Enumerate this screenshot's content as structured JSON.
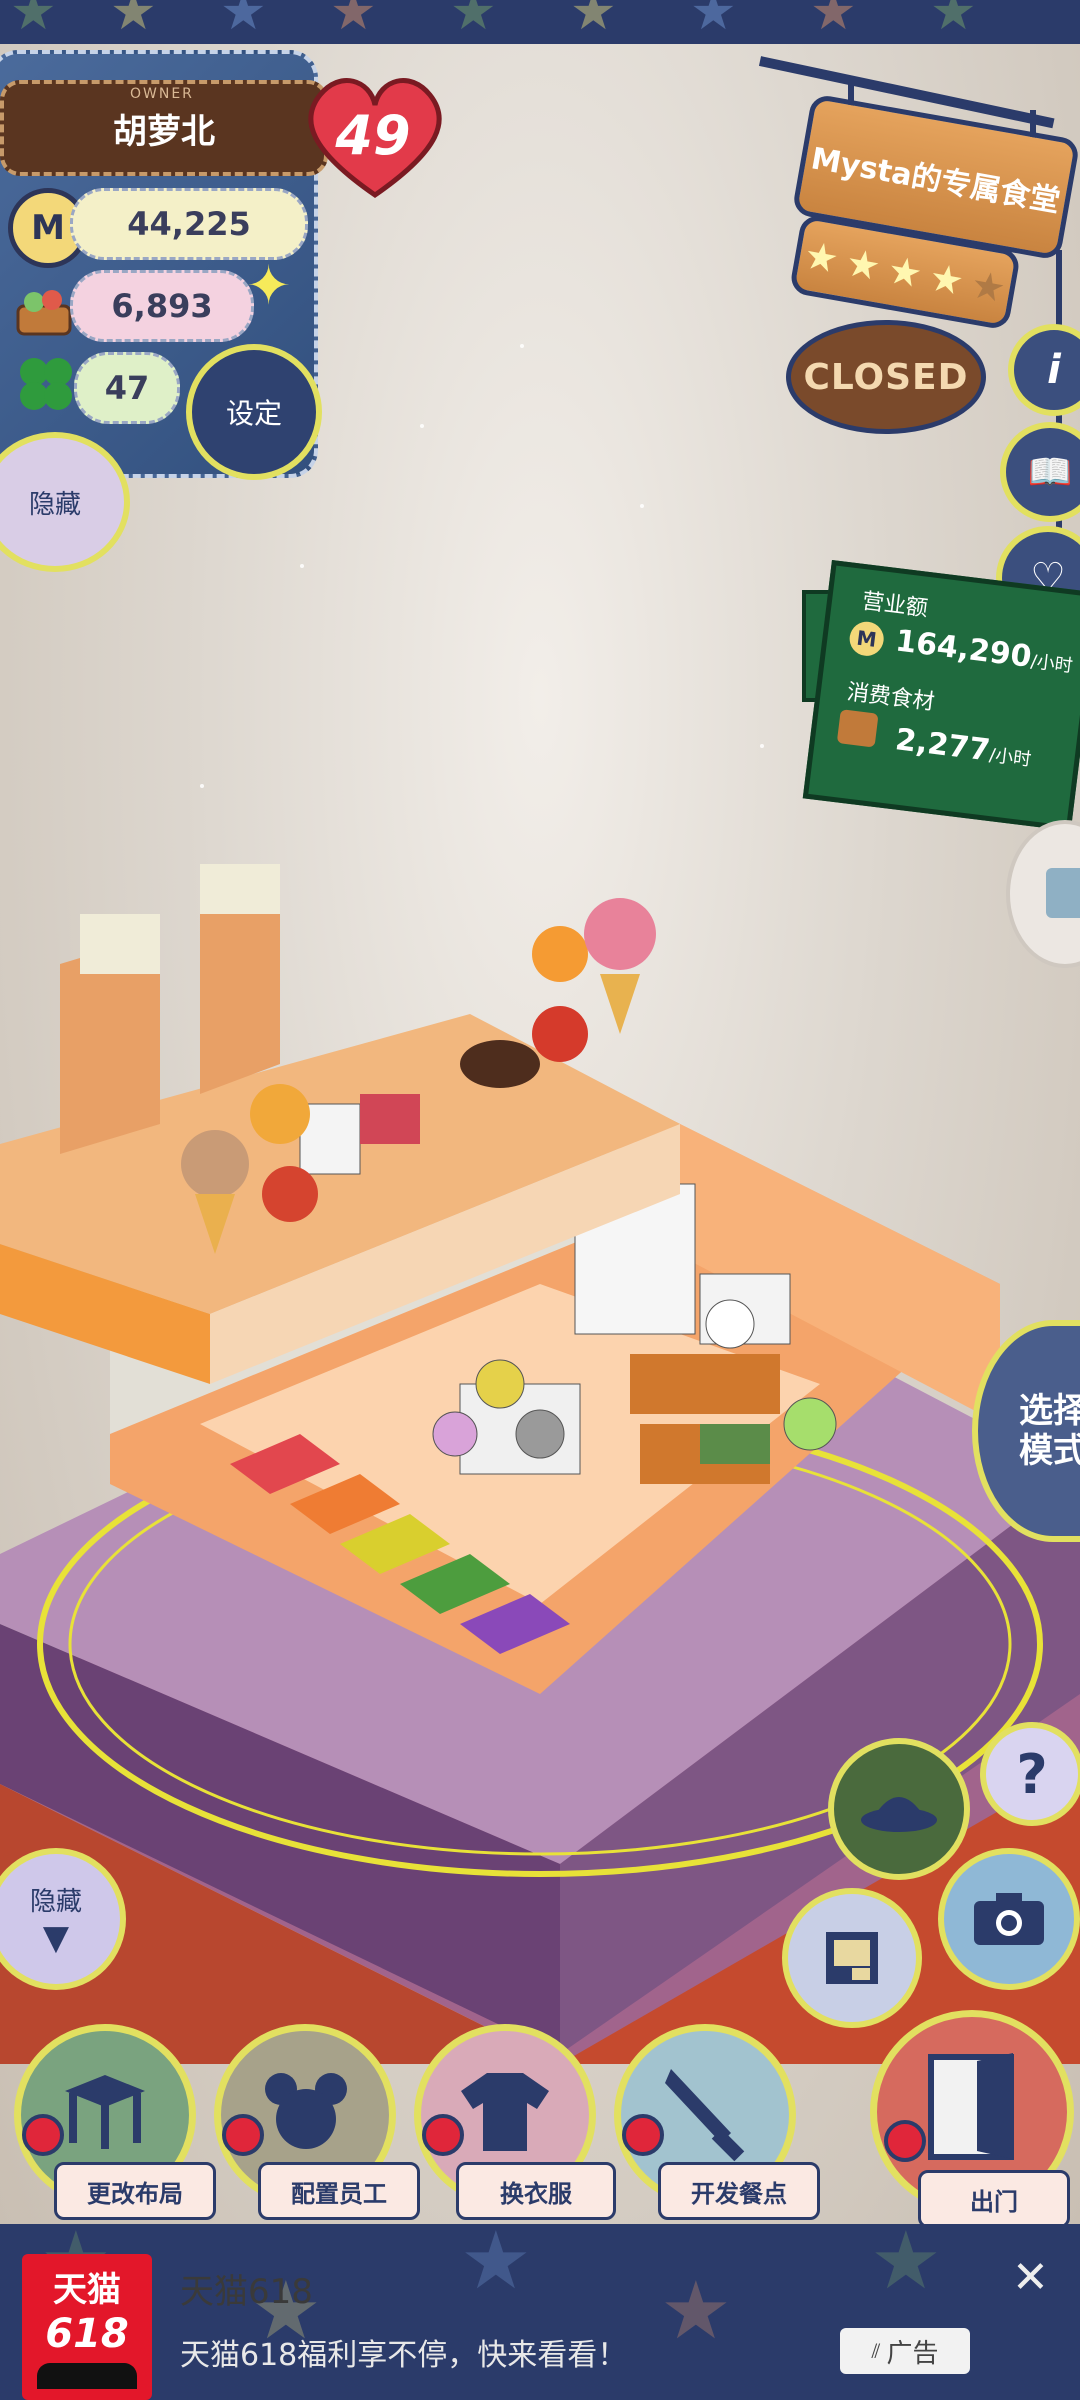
{
  "owner": {
    "tag": "OWNER",
    "name": "胡萝北",
    "level": "49"
  },
  "stats": {
    "coins": "44,225",
    "ingredients": "6,893",
    "clover": "47"
  },
  "buttons": {
    "settings": "设定",
    "hide_left": "隐藏",
    "hide_bottom": "隐藏",
    "mode": "选择模式"
  },
  "restaurant": {
    "title": "Mysta的专属食堂",
    "rating": 4,
    "status": "CLOSED"
  },
  "revenue": {
    "sales_label": "营业额",
    "sales_value": "164,290",
    "sales_unit": "/小时",
    "consume_label": "消费食材",
    "consume_value": "2,277",
    "consume_unit": "/小时"
  },
  "bottom_nav": [
    {
      "label": "更改布局",
      "icon": "table-icon",
      "color": "#7aa37f"
    },
    {
      "label": "配置员工",
      "icon": "mouse-icon",
      "color": "#a7a28a"
    },
    {
      "label": "换衣服",
      "icon": "shirt-icon",
      "color": "#d9aab8"
    },
    {
      "label": "开发餐点",
      "icon": "knife-icon",
      "color": "#a2c3cf"
    },
    {
      "label": "出门",
      "icon": "door-icon",
      "color": "#d66a5e"
    }
  ],
  "ad": {
    "logo_line1": "天猫",
    "logo_line2": "618",
    "title": "天猫618",
    "description": "天猫618福利享不停，快来看看！",
    "badge": "广告"
  }
}
